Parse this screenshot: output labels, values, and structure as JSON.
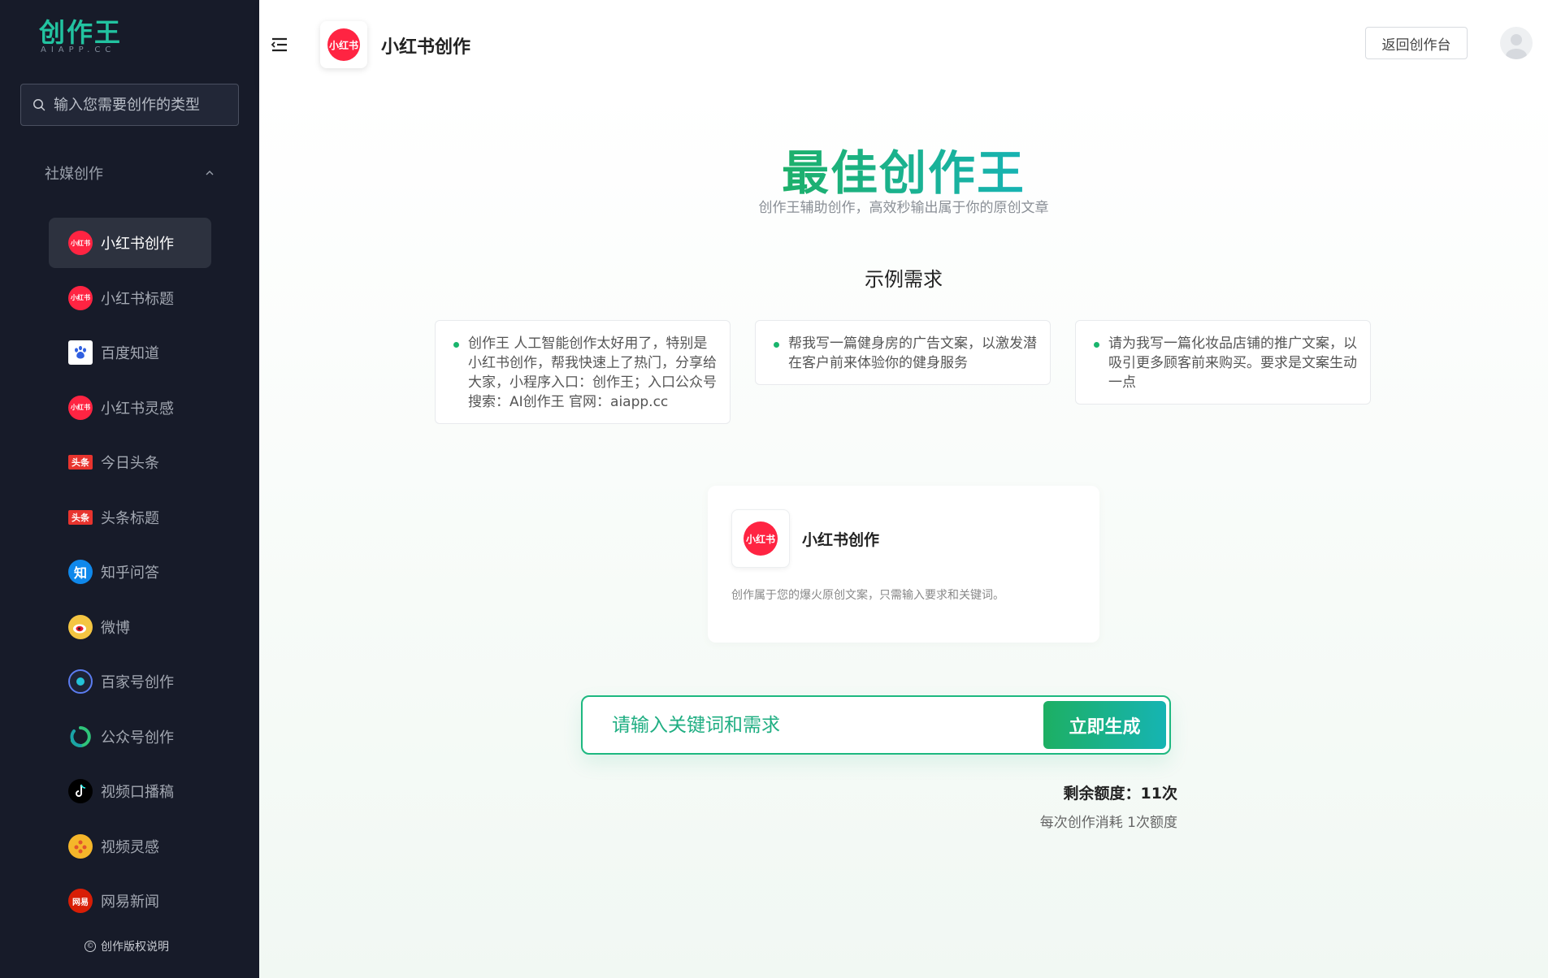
{
  "sidebar": {
    "logo": {
      "text": "创作王",
      "sub": "AIAPP.CC"
    },
    "search": {
      "placeholder": "输入您需要创作的类型"
    },
    "group": {
      "label": "社媒创作"
    },
    "items": [
      {
        "label": "小红书创作",
        "icon": "xiaohongshu-icon",
        "active": true
      },
      {
        "label": "小红书标题",
        "icon": "xiaohongshu-icon"
      },
      {
        "label": "百度知道",
        "icon": "baidu-paw-icon"
      },
      {
        "label": "小红书灵感",
        "icon": "xiaohongshu-icon"
      },
      {
        "label": "今日头条",
        "icon": "toutiao-icon"
      },
      {
        "label": "头条标题",
        "icon": "toutiao-icon"
      },
      {
        "label": "知乎问答",
        "icon": "zhihu-icon"
      },
      {
        "label": "微博",
        "icon": "weibo-icon"
      },
      {
        "label": "百家号创作",
        "icon": "baijiahao-icon"
      },
      {
        "label": "公众号创作",
        "icon": "wechat-official-icon"
      },
      {
        "label": "视频口播稿",
        "icon": "tiktok-icon"
      },
      {
        "label": "视频灵感",
        "icon": "video-reel-icon"
      },
      {
        "label": "网易新闻",
        "icon": "netease-icon"
      }
    ],
    "copyright": "创作版权说明"
  },
  "header": {
    "title": "小红书创作",
    "back_button": "返回创作台"
  },
  "icons": {
    "xhs_text": "小红书",
    "toutiao_text": "头条",
    "zhihu_text": "知",
    "netease_text": "网易",
    "copyright_symbol": "©"
  },
  "main": {
    "hero_title": "最佳创作王",
    "hero_subtitle": "创作王辅助创作，高效秒输出属于你的原创文章",
    "examples_title": "示例需求",
    "examples": [
      "创作王 人工智能创作太好用了，特别是小红书创作，帮我快速上了热门，分享给大家，小程序入口：创作王；入口公众号搜索：AI创作王 官网：aiapp.cc",
      "帮我写一篇健身房的广告文案，以激发潜在客户前来体验你的健身服务",
      "请为我写一篇化妆品店铺的推广文案，以吸引更多顾客前来购买。要求是文案生动一点"
    ],
    "tool": {
      "name": "小红书创作",
      "description": "创作属于您的爆火原创文案，只需输入要求和关键词。"
    },
    "input": {
      "placeholder": "请输入关键词和需求",
      "value": ""
    },
    "generate_button": "立即生成",
    "quota": "剩余额度：11次",
    "quota_note": "每次创作消耗 1次额度"
  },
  "colors": {
    "sidebar_bg": "#171b29",
    "accent_green": "#1db880",
    "xhs_red": "#ff2442",
    "toutiao_red": "#e8342e",
    "zhihu_blue": "#0f88eb"
  }
}
